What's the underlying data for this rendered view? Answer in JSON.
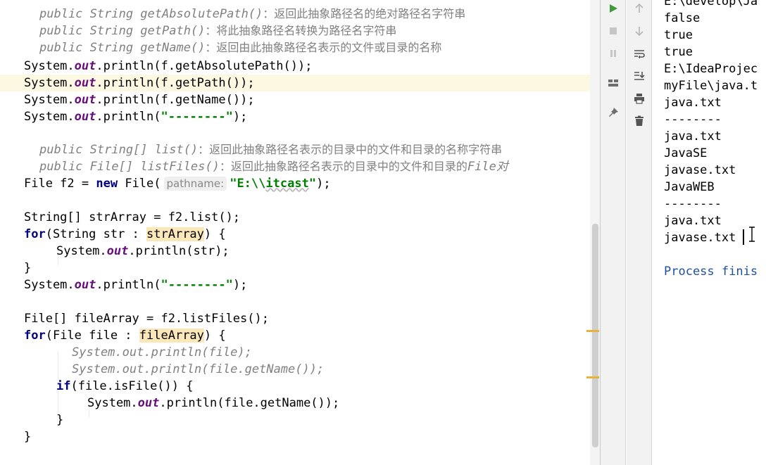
{
  "editor": {
    "comments": {
      "abs_sig": "public String getAbsolutePath()",
      "abs_desc": "：返回此抽象路径名的绝对路径名字符串",
      "path_sig": "public String getPath()",
      "path_desc": "：将此抽象路径名转换为路径名字符串",
      "name_sig": "public String getName()",
      "name_desc": "：返回由此抽象路径名表示的文件或目录的名称",
      "list_sig": "public String[] list()",
      "list_desc": "：返回此抽象路径名表示的目录中的文件和目录的名称字符串",
      "listfiles_sig": "public File[] listFiles()",
      "listfiles_desc": "：返回此抽象路径名表示的目录中的文件和目录的",
      "listfiles_tail": "File对"
    },
    "tokens": {
      "system": "System.",
      "out": "out",
      "println_open": ".println(",
      "f_abs": "f.getAbsolutePath());",
      "f_path": "f.getPath());",
      "f_name": "f.getName());",
      "dashes": "\"--------\"",
      "close_semi": ");",
      "file_f2_decl": "File f2 = ",
      "new_kw": "new",
      "file_ctor": " File(",
      "hint_pathname": "pathname:",
      "str_open": "\"E:",
      "str_escape": "\\\\",
      "str_itcast": "itcast",
      "str_close": "\"",
      "strarray_decl": "String[] strArray = f2.list();",
      "for_kw": "for",
      "for1_mid": "(String str : ",
      "strArray": "strArray",
      "for_close": ") {",
      "println_str": ".println(str);",
      "close_brace": "}",
      "filearray_decl": "File[] fileArray = f2.listFiles();",
      "for2_mid": "(File file : ",
      "fileArray": "fileArray",
      "dim_println_file": "System.out.println(file);",
      "dim_println_getname": "System.out.println(file.getName());",
      "if_kw": "if",
      "if_rest": "(file.isFile()) {",
      "println_getname": ".println(file.getName());"
    }
  },
  "console": {
    "lines": [
      "E:\\develop\\Ja",
      "false",
      "true",
      "true",
      "E:\\IdeaProjec",
      "myFile\\java.t",
      "java.txt",
      "--------",
      "java.txt",
      "JavaSE",
      "javase.txt",
      "JavaWEB",
      "--------",
      "java.txt",
      "javase.txt"
    ],
    "process": "Process finis"
  },
  "toolbar": {
    "left": [
      "run-icon",
      "stop-icon",
      "pause-icon",
      "layout-icon",
      "pin-icon"
    ],
    "right": [
      "up-arrow-icon",
      "down-arrow-icon",
      "soft-wrap-icon",
      "scroll-to-end-icon",
      "print-icon",
      "trash-icon"
    ]
  },
  "colors": {
    "keyword": "#000080",
    "string": "#008000",
    "field": "#660e7a",
    "comment": "#808080",
    "process_text": "#1e50a2",
    "current_line": "#fdf8e1",
    "usage_highlight": "#fbe7b8",
    "scroll_marker": "#e8b23a",
    "run_green": "#3d9b3d"
  }
}
